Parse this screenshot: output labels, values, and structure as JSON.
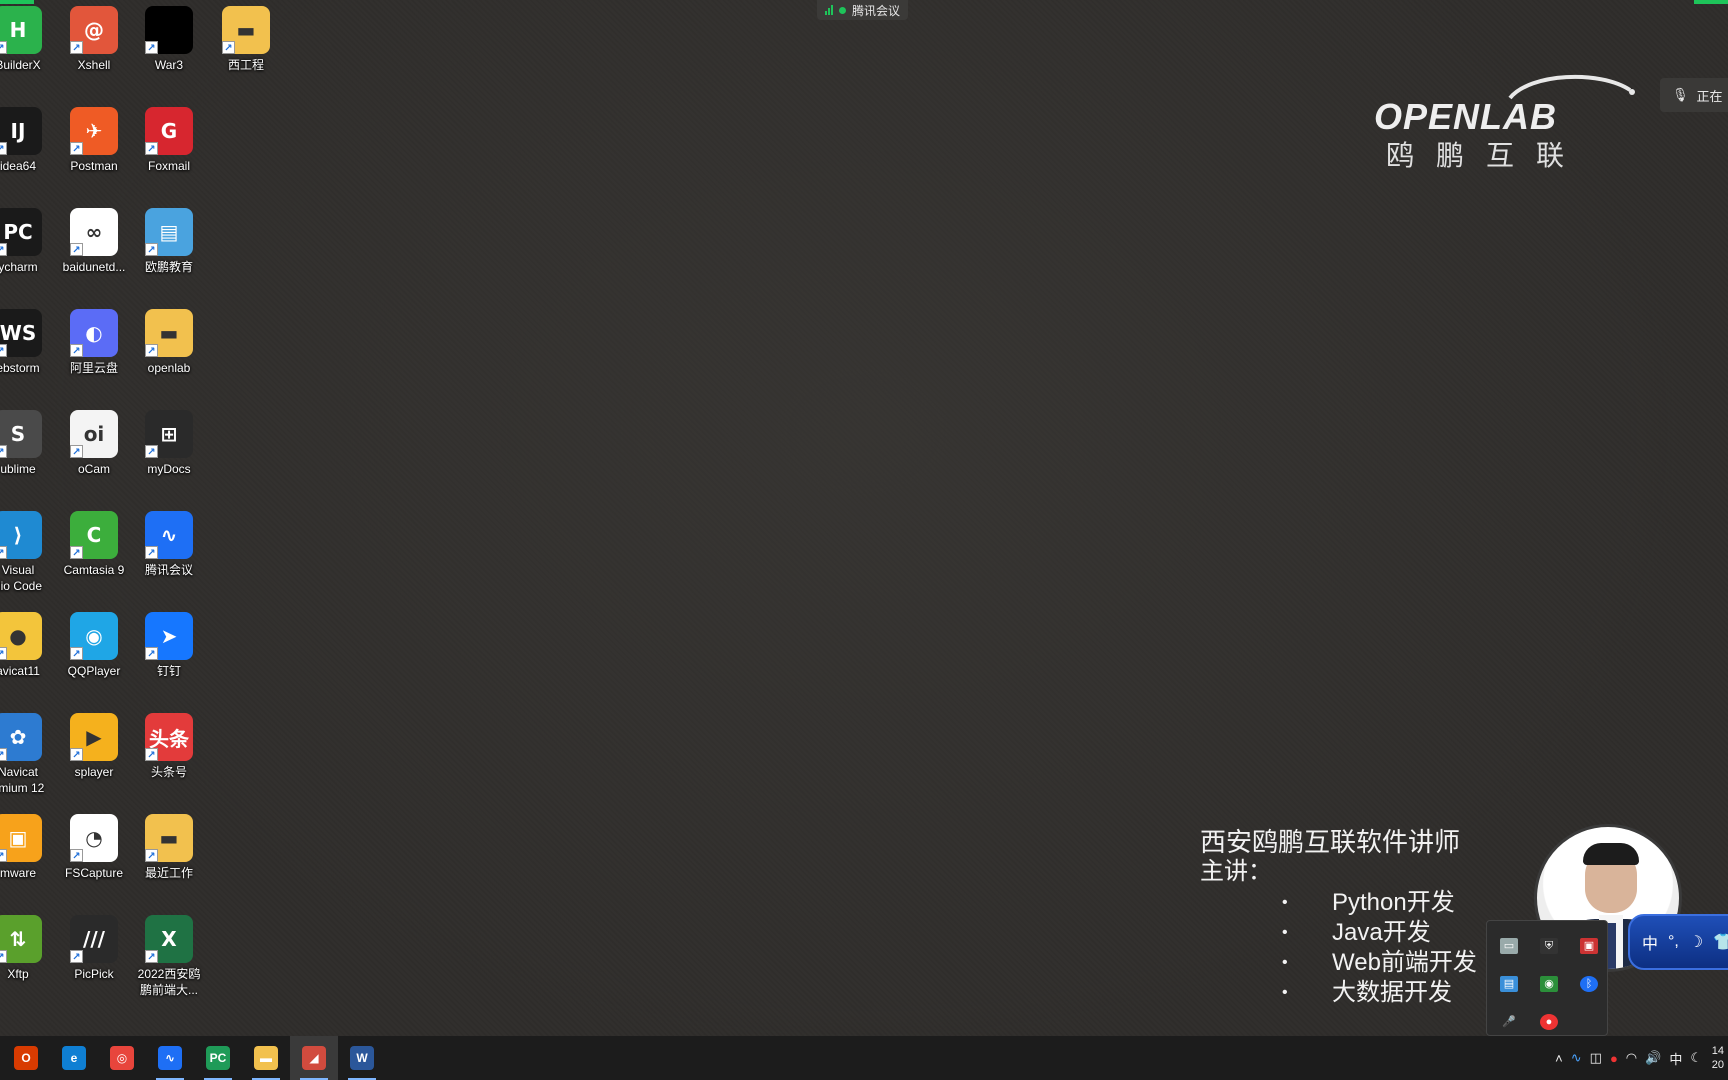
{
  "meeting": {
    "label": "腾讯会议"
  },
  "desktop": {
    "icons": [
      {
        "label": "BuilderX",
        "glyph": "H",
        "color": "#2bb24c"
      },
      {
        "label": "idea64",
        "glyph": "IJ",
        "color": "#1a1a1a"
      },
      {
        "label": "ycharm",
        "glyph": "PC",
        "color": "#1a1a1a"
      },
      {
        "label": "ebstorm",
        "glyph": "WS",
        "color": "#1a1a1a"
      },
      {
        "label": "ublime",
        "glyph": "S",
        "color": "#4a4a4a"
      },
      {
        "label": "Visual\ndio Code",
        "glyph": "⟩",
        "color": "#1f8ad2"
      },
      {
        "label": "avicat11",
        "glyph": "●",
        "color": "#f3c53b"
      },
      {
        "label": "Navicat\nemium 12",
        "glyph": "✿",
        "color": "#2d7bd1"
      },
      {
        "label": "mware",
        "glyph": "▣",
        "color": "#f7a21b"
      },
      {
        "label": "Xftp",
        "glyph": "⇅",
        "color": "#5aa02c"
      },
      {
        "label": "Xshell",
        "glyph": "@",
        "color": "#e2563b"
      },
      {
        "label": "Postman",
        "glyph": "✈",
        "color": "#ef5b25"
      },
      {
        "label": "baidunetd...",
        "glyph": "∞",
        "color": "#ffffff"
      },
      {
        "label": "阿里云盘",
        "glyph": "◐",
        "color": "#5b6cf6"
      },
      {
        "label": "oCam",
        "glyph": "oi",
        "color": "#f4f4f4"
      },
      {
        "label": "Camtasia 9",
        "glyph": "C",
        "color": "#3cae3c"
      },
      {
        "label": "QQPlayer",
        "glyph": "◉",
        "color": "#1fa6e6"
      },
      {
        "label": "splayer",
        "glyph": "▶",
        "color": "#f5b11d"
      },
      {
        "label": "FSCapture",
        "glyph": "◔",
        "color": "#ffffff"
      },
      {
        "label": "PicPick",
        "glyph": "///",
        "color": "#2a2a2a"
      },
      {
        "label": "War3",
        "glyph": "",
        "color": "#000000"
      },
      {
        "label": "Foxmail",
        "glyph": "G",
        "color": "#d7262f"
      },
      {
        "label": "欧鹏教育",
        "glyph": "▤",
        "color": "#4aa3df"
      },
      {
        "label": "openlab",
        "glyph": "▬",
        "color": "#f2c14e"
      },
      {
        "label": "myDocs",
        "glyph": "⊞",
        "color": "#2a2a2a"
      },
      {
        "label": "腾讯会议",
        "glyph": "∿",
        "color": "#1e6ff5"
      },
      {
        "label": "钉钉",
        "glyph": "➤",
        "color": "#1677ff"
      },
      {
        "label": "头条号",
        "glyph": "头条",
        "color": "#e33b3b"
      },
      {
        "label": "最近工作",
        "glyph": "▬",
        "color": "#f2c14e"
      },
      {
        "label": "2022西安鸥\n鹏前端大...",
        "glyph": "X",
        "color": "#1f7244"
      },
      {
        "label": "西工程",
        "glyph": "▬",
        "color": "#f2c14e"
      }
    ]
  },
  "logo": {
    "wordmark": "OPENLAB",
    "chinese": "鸥鹏互联"
  },
  "speaking_chip": {
    "label": "正在"
  },
  "instructor": {
    "title": "西安鸥鹏互联软件讲师",
    "lead": "主讲：",
    "topics": [
      "Python开发",
      "Java开发",
      "Web前端开发",
      "大数据开发"
    ]
  },
  "tray_popup": {
    "icons": [
      "battery-icon",
      "shield-icon",
      "monitor-icon",
      "app-icon",
      "sync-icon",
      "bluetooth-icon",
      "mic-icon",
      "record-icon"
    ]
  },
  "ime": {
    "mode": "中",
    "punct": "°,",
    "moon": "☽",
    "shirt": "👕"
  },
  "taskbar": {
    "apps": [
      {
        "name": "office",
        "glyph": "O",
        "color": "#d83b01"
      },
      {
        "name": "edge",
        "glyph": "e",
        "color": "#0f7fd3"
      },
      {
        "name": "chrome",
        "glyph": "◎",
        "color": "#e8453c"
      },
      {
        "name": "tencent-meeting",
        "glyph": "∿",
        "color": "#1e6ff5"
      },
      {
        "name": "pycharm",
        "glyph": "PC",
        "color": "#1f9b58"
      },
      {
        "name": "file-explorer",
        "glyph": "▬",
        "color": "#f2c14e"
      },
      {
        "name": "presentation-tool",
        "glyph": "◢",
        "color": "#d14b3e"
      },
      {
        "name": "word",
        "glyph": "W",
        "color": "#2b579a"
      }
    ],
    "tray": {
      "ime": "中",
      "clock_line1": "14",
      "clock_line2": "20"
    }
  }
}
